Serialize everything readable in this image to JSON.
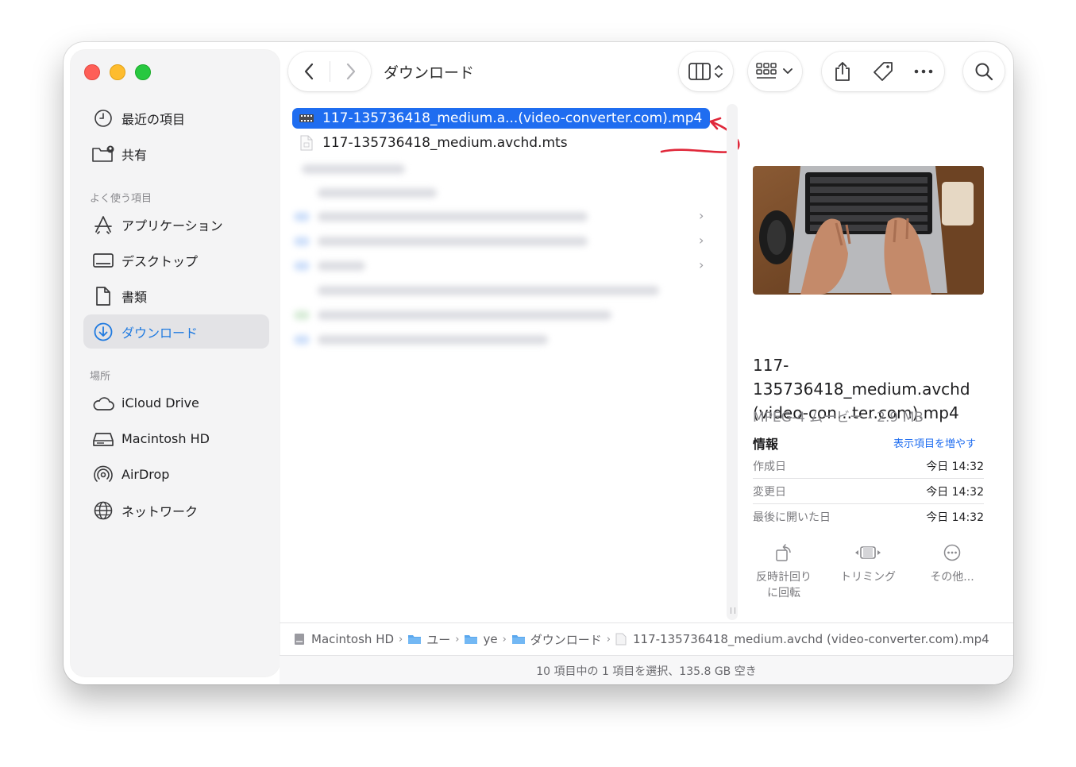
{
  "window": {
    "title": "ダウンロード"
  },
  "sidebar": {
    "recents": [
      {
        "label": "最近の項目",
        "icon": "clock-icon"
      },
      {
        "label": "共有",
        "icon": "shared-folder-icon"
      }
    ],
    "favorites_title": "よく使う項目",
    "favorites": [
      {
        "label": "アプリケーション",
        "icon": "applications-icon"
      },
      {
        "label": "デスクトップ",
        "icon": "desktop-icon"
      },
      {
        "label": "書類",
        "icon": "document-icon"
      },
      {
        "label": "ダウンロード",
        "icon": "download-icon",
        "selected": true
      }
    ],
    "locations_title": "場所",
    "locations": [
      {
        "label": "iCloud Drive",
        "icon": "cloud-icon"
      },
      {
        "label": "Macintosh HD",
        "icon": "hard-drive-icon"
      },
      {
        "label": "AirDrop",
        "icon": "airdrop-icon"
      },
      {
        "label": "ネットワーク",
        "icon": "globe-icon"
      }
    ]
  },
  "files": [
    {
      "name": "117-135736418_medium.a...(video-converter.com).mp4",
      "icon": "video-file-icon",
      "selected": true
    },
    {
      "name": "117-135736418_medium.avchd.mts",
      "icon": "generic-file-icon",
      "selected": false
    }
  ],
  "preview": {
    "file_name": "117-135736418_medium.avchd (video-con...ter.com).mp4",
    "kind_size": "MPEG-4 ムービー - 2.9 MB",
    "info_heading": "情報",
    "more_link": "表示項目を増やす",
    "info": [
      {
        "label": "作成日",
        "value": "今日 14:32"
      },
      {
        "label": "変更日",
        "value": "今日 14:32"
      },
      {
        "label": "最後に開いた日",
        "value": "今日 14:32"
      }
    ],
    "actions": [
      {
        "label": "反時計回り\nに回転",
        "icon": "rotate-left-icon"
      },
      {
        "label": "トリミング",
        "icon": "trim-icon"
      },
      {
        "label": "その他...",
        "icon": "more-circle-icon"
      }
    ]
  },
  "path_bar": [
    {
      "label": "Macintosh HD",
      "icon": "hard-drive-icon"
    },
    {
      "label": "ユー",
      "icon": "folder-icon"
    },
    {
      "label": "ye",
      "icon": "folder-icon"
    },
    {
      "label": "ダウンロード",
      "icon": "folder-icon"
    },
    {
      "label": "117-135736418_medium.avchd (video-converter.com).mp4",
      "icon": "generic-file-icon"
    }
  ],
  "status_bar": "10 項目中の 1 項目を選択、135.8 GB 空き",
  "colors": {
    "accent": "#1f6df0",
    "annotation_arrow": "#e0283a",
    "selection": "#1f6df0"
  }
}
